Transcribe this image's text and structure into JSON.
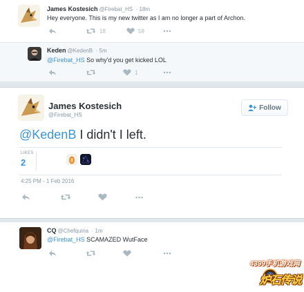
{
  "tweets": [
    {
      "name": "James Kostesich",
      "handle": "@Firebat_HS",
      "time": "· 18m",
      "text": "Hey everyone. This is my new twitter as I am no longer a part of Archon.",
      "retweets": "18",
      "likes": "59"
    },
    {
      "name": "Keden",
      "handle": "@KedenB",
      "time": "· 5m",
      "mention": "@Firebat_HS",
      "text": " So why'd you get kicked LOL",
      "likes": "1"
    },
    {
      "name": "James Kostesich",
      "handle": "@Firebat_HS",
      "follow_label": "Follow",
      "mention": "@KedenB",
      "text": " I didn't I left.",
      "likes_label": "LIKES",
      "likes_count": "2",
      "timestamp": "4:25 PM - 1 Feb 2016"
    },
    {
      "name": "CQ",
      "handle": "@Chefquina",
      "time": "· 1m",
      "mention": "@Firebat_HS",
      "text": " SCAMAZED WutFace"
    }
  ],
  "watermark": {
    "text": "4399手机游戏网",
    "logo_text": "炉石传说"
  },
  "icons": [
    "reply-icon",
    "retweet-icon",
    "heart-icon",
    "more-icon",
    "follow-person-icon"
  ],
  "colors": {
    "link": "#3b94d9",
    "icon": "#aab8c2",
    "meta": "#8899a6"
  }
}
